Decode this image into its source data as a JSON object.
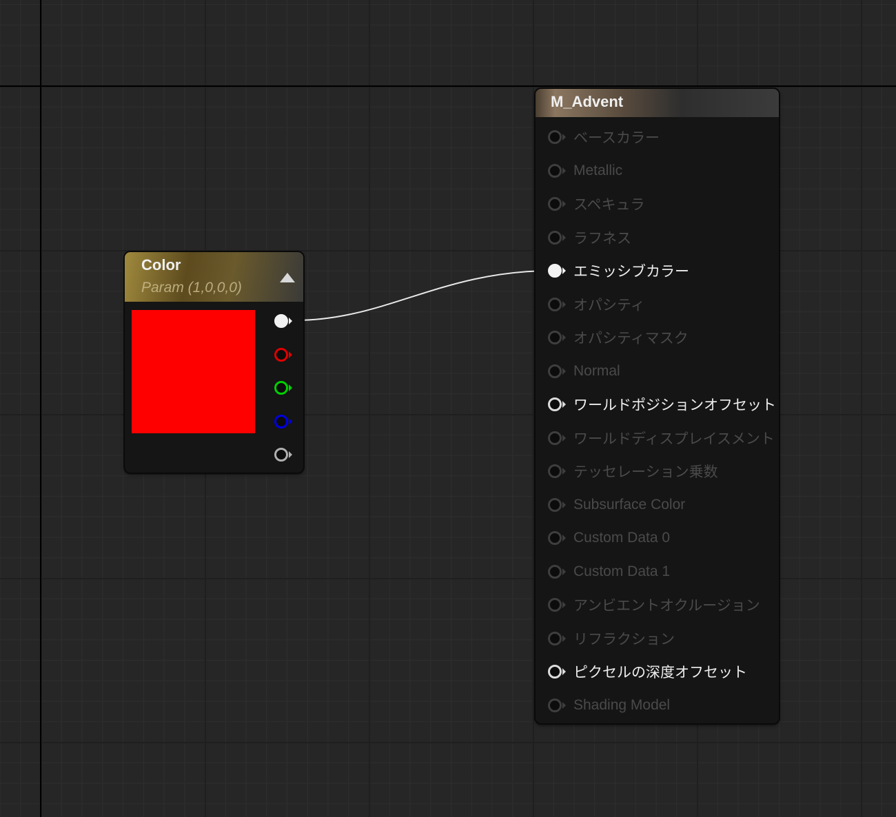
{
  "color_node": {
    "title": "Color",
    "subtitle": "Param (1,0,0,0)",
    "swatch_color": "#ff0000",
    "pins": [
      {
        "name": "rgb",
        "color": "#f2f2f2",
        "connected": true
      },
      {
        "name": "r",
        "color": "#e00000",
        "connected": false
      },
      {
        "name": "g",
        "color": "#00d000",
        "connected": false
      },
      {
        "name": "b",
        "color": "#0000e0",
        "connected": false
      },
      {
        "name": "a",
        "color": "#b0b0b0",
        "connected": false
      }
    ]
  },
  "material_node": {
    "title": "M_Advent",
    "inputs": [
      {
        "label": "ベースカラー",
        "state": "inactive"
      },
      {
        "label": "Metallic",
        "state": "inactive"
      },
      {
        "label": "スペキュラ",
        "state": "inactive"
      },
      {
        "label": "ラフネス",
        "state": "inactive"
      },
      {
        "label": "エミッシブカラー",
        "state": "connected"
      },
      {
        "label": "オパシティ",
        "state": "inactive"
      },
      {
        "label": "オパシティマスク",
        "state": "inactive"
      },
      {
        "label": "Normal",
        "state": "inactive"
      },
      {
        "label": "ワールドポジションオフセット",
        "state": "active"
      },
      {
        "label": "ワールドディスプレイスメント",
        "state": "inactive"
      },
      {
        "label": "テッセレーション乗数",
        "state": "inactive"
      },
      {
        "label": "Subsurface Color",
        "state": "inactive"
      },
      {
        "label": "Custom Data 0",
        "state": "inactive"
      },
      {
        "label": "Custom Data 1",
        "state": "inactive"
      },
      {
        "label": "アンビエントオクルージョン",
        "state": "inactive"
      },
      {
        "label": "リフラクション",
        "state": "inactive"
      },
      {
        "label": "ピクセルの深度オフセット",
        "state": "active"
      },
      {
        "label": "Shading Model",
        "state": "inactive"
      }
    ]
  }
}
